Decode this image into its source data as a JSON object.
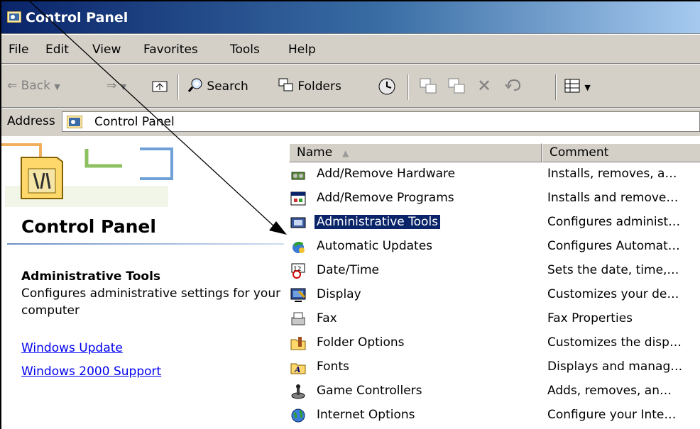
{
  "window": {
    "title": "Control Panel"
  },
  "menubar": {
    "items": [
      "File",
      "Edit",
      "View",
      "Favorites",
      "Tools",
      "Help"
    ]
  },
  "toolbar": {
    "back_label": "Back",
    "search_label": "Search",
    "folders_label": "Folders"
  },
  "address": {
    "label": "Address",
    "value": "Control Panel"
  },
  "leftpane": {
    "title": "Control Panel",
    "selected_title": "Administrative Tools",
    "selected_desc": "Configures administrative settings for your computer",
    "links": [
      "Windows Update",
      "Windows 2000 Support"
    ]
  },
  "list": {
    "columns": {
      "name": "Name",
      "comment": "Comment"
    },
    "sort_indicator": "▲",
    "items": [
      {
        "name": "Add/Remove Hardware",
        "comment": "Installs, removes, a…",
        "icon": "hardware-icon"
      },
      {
        "name": "Add/Remove Programs",
        "comment": "Installs and remove…",
        "icon": "programs-icon"
      },
      {
        "name": "Administrative Tools",
        "comment": "Configures administ…",
        "icon": "admin-tools-icon",
        "selected": true
      },
      {
        "name": "Automatic Updates",
        "comment": "Configures Automat…",
        "icon": "updates-icon"
      },
      {
        "name": "Date/Time",
        "comment": "Sets the date, time,…",
        "icon": "clock-icon"
      },
      {
        "name": "Display",
        "comment": "Customizes your de…",
        "icon": "display-icon"
      },
      {
        "name": "Fax",
        "comment": "Fax Properties",
        "icon": "fax-icon"
      },
      {
        "name": "Folder Options",
        "comment": "Customizes the disp…",
        "icon": "folder-options-icon"
      },
      {
        "name": "Fonts",
        "comment": "Displays and manag…",
        "icon": "fonts-icon"
      },
      {
        "name": "Game Controllers",
        "comment": "Adds, removes, an…",
        "icon": "joystick-icon"
      },
      {
        "name": "Internet Options",
        "comment": "Configure your Inte…",
        "icon": "globe-icon"
      }
    ]
  },
  "colors": {
    "titlebar": "#0a246a",
    "selection": "#0a246a",
    "link": "#0000ee",
    "chrome": "#d4d0c8"
  }
}
